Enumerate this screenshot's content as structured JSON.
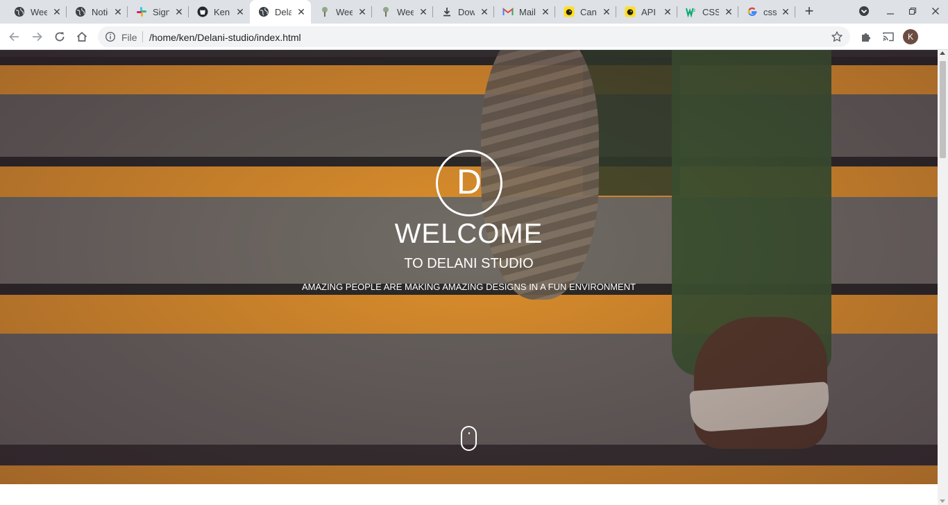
{
  "browser": {
    "tabs": [
      {
        "title": "Week",
        "favicon": "globe-icon"
      },
      {
        "title": "Notion",
        "favicon": "globe-icon"
      },
      {
        "title": "Sign",
        "favicon": "slack-icon"
      },
      {
        "title": "Ken",
        "favicon": "github-icon"
      },
      {
        "title": "Dela",
        "favicon": "globe-icon",
        "active": true
      },
      {
        "title": "Wee",
        "favicon": "tree-icon"
      },
      {
        "title": "Wee",
        "favicon": "tree-icon"
      },
      {
        "title": "Dow",
        "favicon": "download-icon"
      },
      {
        "title": "Mail",
        "favicon": "gmail-icon"
      },
      {
        "title": "Can",
        "favicon": "mailchimp-icon"
      },
      {
        "title": "API",
        "favicon": "mailchimp-icon"
      },
      {
        "title": "CSS",
        "favicon": "w3schools-icon"
      },
      {
        "title": "css",
        "favicon": "google-icon"
      }
    ],
    "tab_close_glyph": "✕",
    "new_tab_glyph": "+",
    "address": {
      "scheme_label": "File",
      "url": "/home/ken/Delani-studio/index.html"
    },
    "profile_initial": "K",
    "accent": "#1a73e8"
  },
  "hero": {
    "logo_letter": "D",
    "heading": "WELCOME",
    "subheading": "TO DELANI STUDIO",
    "tagline": "AMAZING PEOPLE ARE MAKING AMAZING DESIGNS IN A FUN ENVIRONMENT",
    "stripe_color": "#e8972e",
    "step_color": "#6b6760"
  }
}
